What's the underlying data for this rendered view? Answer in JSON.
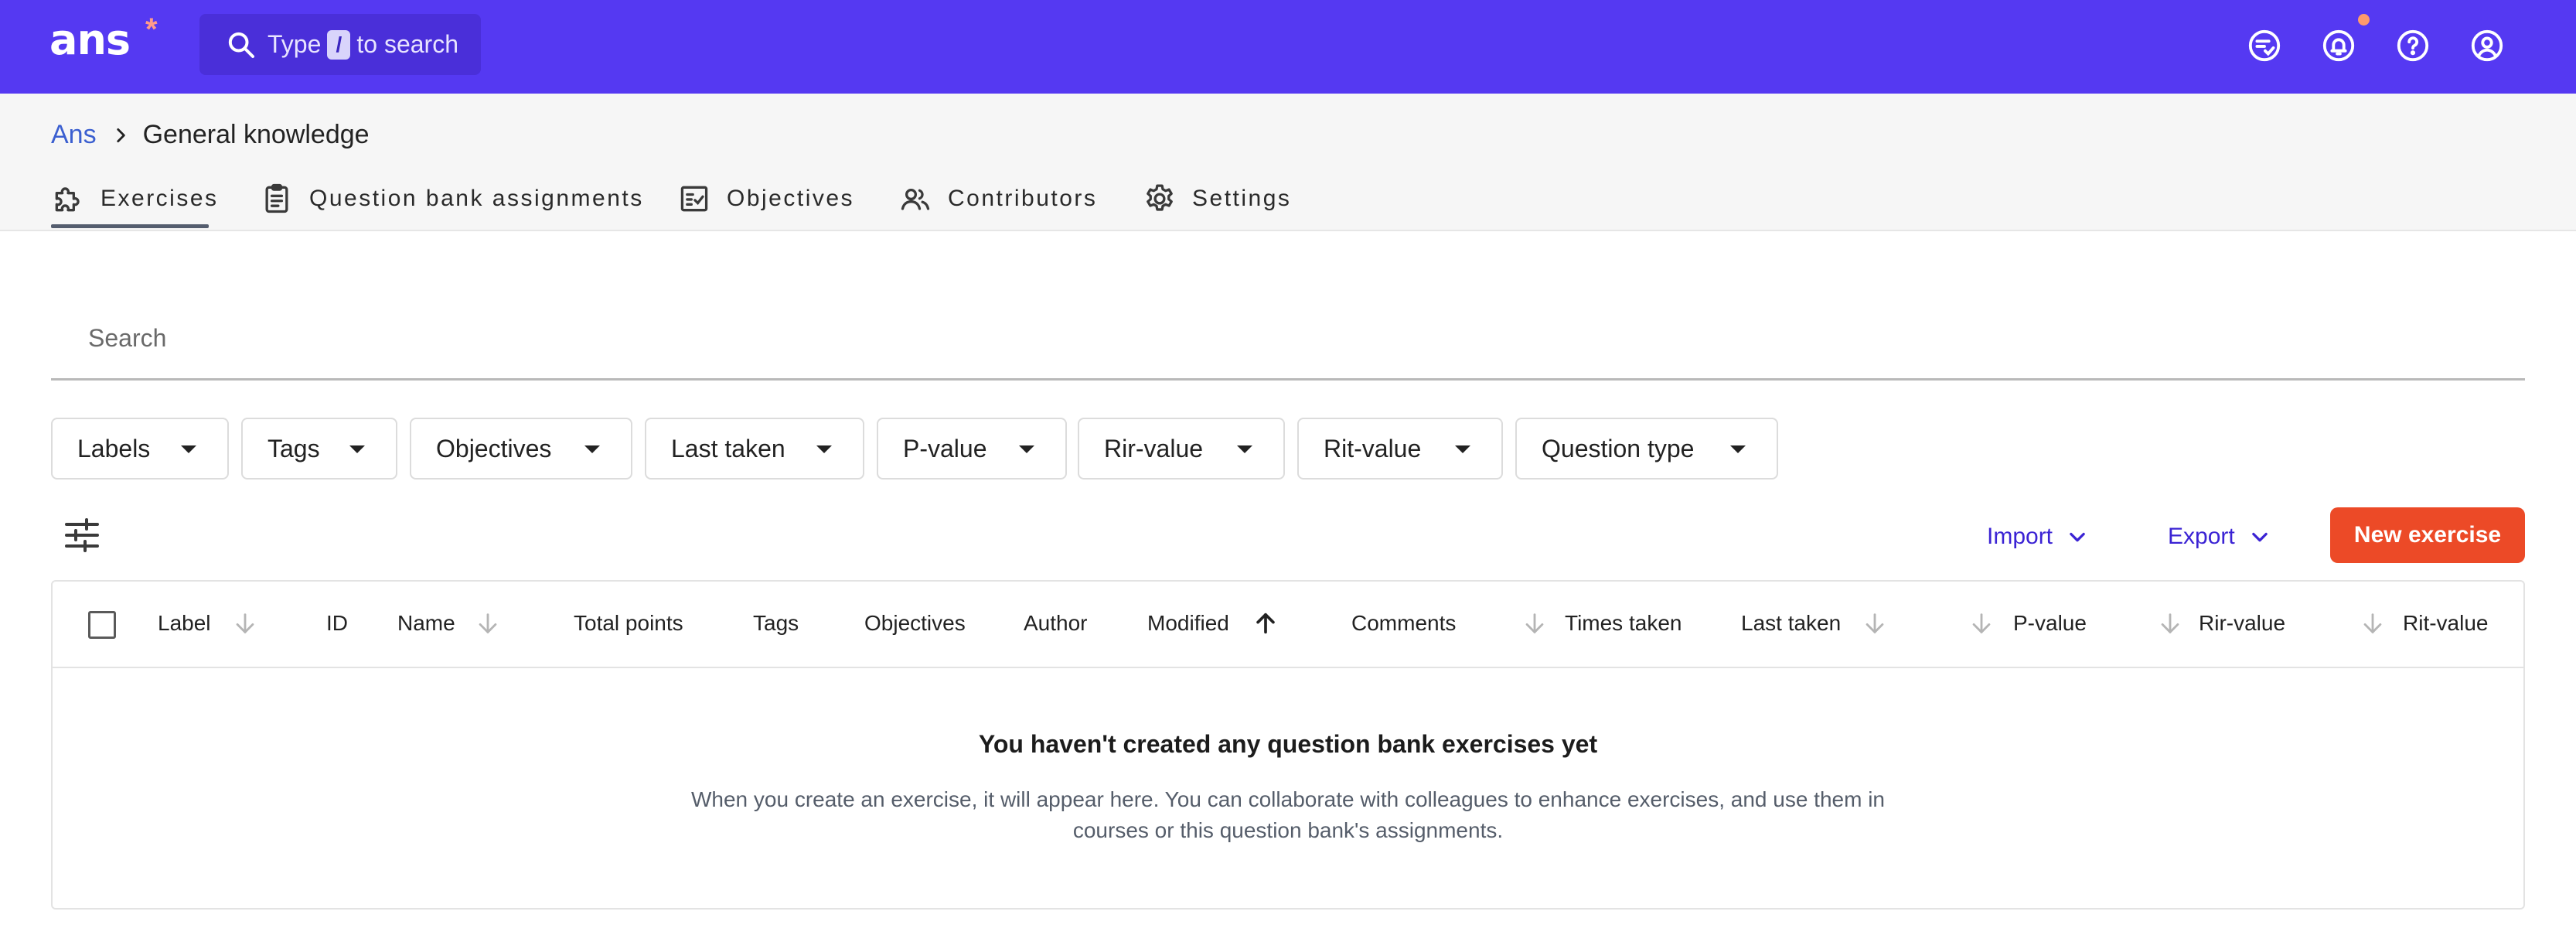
{
  "app": {
    "logo": "ans",
    "logo_mark": "*",
    "search_prefix": "Type",
    "search_key": "/",
    "search_suffix": "to search",
    "top_icons": [
      "review-icon",
      "bell-icon",
      "help-icon",
      "account-icon"
    ],
    "accent": "#5539f2"
  },
  "breadcrumb": {
    "root": "Ans",
    "current": "General knowledge"
  },
  "tabs": [
    {
      "label": "Exercises",
      "icon": "puzzle-icon",
      "active": true
    },
    {
      "label": "Question bank assignments",
      "icon": "clipboard-icon",
      "active": false
    },
    {
      "label": "Objectives",
      "icon": "checklist-icon",
      "active": false
    },
    {
      "label": "Contributors",
      "icon": "people-icon",
      "active": false
    },
    {
      "label": "Settings",
      "icon": "gear-icon",
      "active": false
    }
  ],
  "search": {
    "placeholder": "Search",
    "value": ""
  },
  "filters": [
    "Labels",
    "Tags",
    "Objectives",
    "Last taken",
    "P-value",
    "Rir-value",
    "Rit-value",
    "Question type"
  ],
  "toolbar": {
    "import_label": "Import",
    "export_label": "Export",
    "new_label": "New exercise",
    "new_color": "#ec4a27"
  },
  "table": {
    "columns": [
      "Label",
      "ID",
      "Name",
      "Total points",
      "Tags",
      "Objectives",
      "Author",
      "Modified",
      "Comments",
      "Times taken",
      "Last taken",
      "P-value",
      "Rir-value",
      "Rit-value"
    ],
    "rows": [],
    "empty_title": "You haven't created any question bank exercises yet",
    "empty_desc_line1": "When you create an exercise, it will appear here. You can collaborate with colleagues to enhance exercises, and use them in",
    "empty_desc_line2": "courses or this question bank's assignments."
  }
}
